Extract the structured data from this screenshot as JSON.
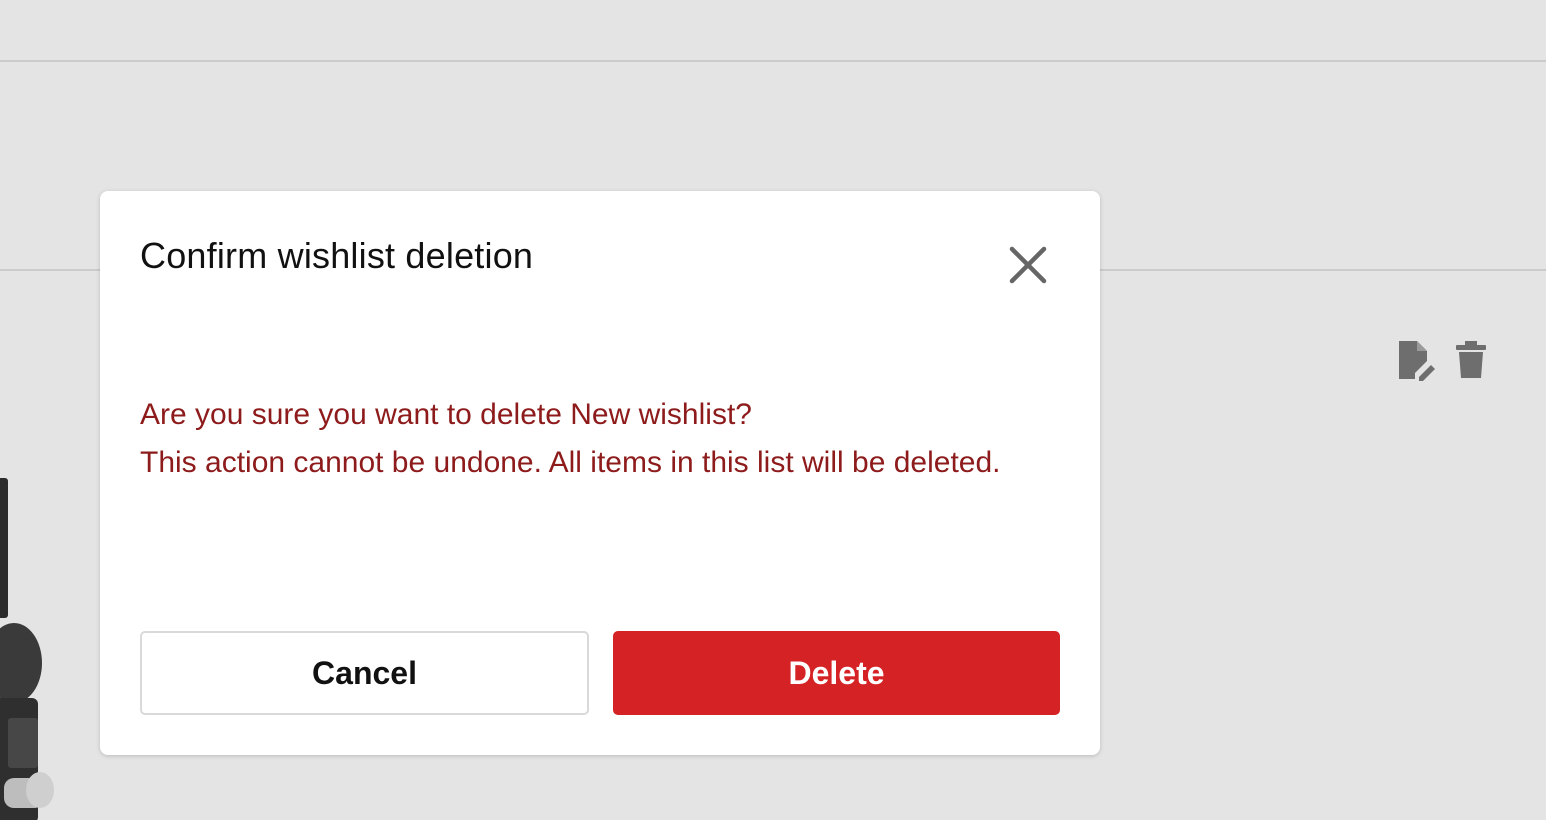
{
  "modal": {
    "title": "Confirm wishlist deletion",
    "message_line1": "Are you sure you want to delete New wishlist?",
    "message_line2": "This action cannot be undone. All items in this list will be deleted.",
    "cancel_label": "Cancel",
    "delete_label": "Delete",
    "close_icon": "close-icon"
  },
  "row_actions": {
    "edit_icon": "edit-document-icon",
    "delete_icon": "trash-icon"
  },
  "colors": {
    "overlay_bg": "#e4e4e4",
    "message_text": "#8e1b1b",
    "delete_button": "#d52224",
    "icon_gray": "#6e6e6e"
  }
}
